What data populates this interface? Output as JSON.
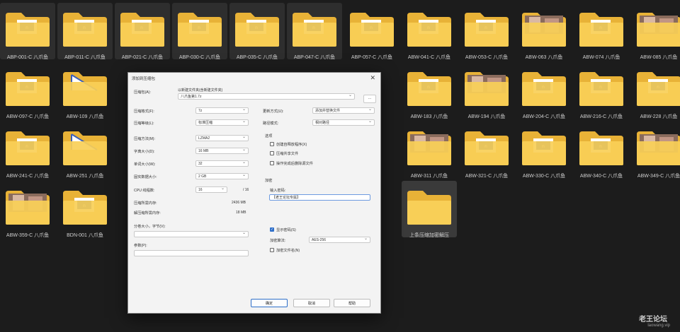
{
  "folders": [
    {
      "label": "ABP-001-C 八爪鱼",
      "thumb": "logo",
      "state": "sel"
    },
    {
      "label": "ABP-011-C 八爪鱼",
      "thumb": "logo",
      "state": "sel"
    },
    {
      "label": "ABP-021-C 八爪鱼",
      "thumb": "logo",
      "state": "sel"
    },
    {
      "label": "ABP-030-C 八爪鱼",
      "thumb": "logo",
      "state": "sel"
    },
    {
      "label": "ABP-035-C 八爪鱼",
      "thumb": "logo",
      "state": "sel"
    },
    {
      "label": "ABP-047-C 八爪鱼",
      "thumb": "logo",
      "state": "sel"
    },
    {
      "label": "ABP-057-C 八爪鱼",
      "thumb": "logo",
      "state": ""
    },
    {
      "label": "ABW-041-C 八爪鱼",
      "thumb": "logo",
      "state": ""
    },
    {
      "label": "ABW-053-C 八爪鱼",
      "thumb": "logo",
      "state": ""
    },
    {
      "label": "ABW-063 八爪鱼",
      "thumb": "photo",
      "state": ""
    },
    {
      "label": "ABW-074 八爪鱼",
      "thumb": "logo",
      "state": ""
    },
    {
      "label": "ABW-085 八爪鱼",
      "thumb": "photo",
      "state": ""
    },
    {
      "label": "ABW-097-C 八爪鱼",
      "thumb": "logo",
      "state": ""
    },
    {
      "label": "ABW-109 八爪鱼",
      "thumb": "doc",
      "state": ""
    },
    {
      "label": "",
      "thumb": "logo",
      "state": "hidden"
    },
    {
      "label": "",
      "thumb": "logo",
      "state": "hidden"
    },
    {
      "label": "",
      "thumb": "logo",
      "state": "hidden"
    },
    {
      "label": "",
      "thumb": "logo",
      "state": "hidden"
    },
    {
      "label": "",
      "thumb": "photo",
      "state": "hidden"
    },
    {
      "label": "ABW-183 八爪鱼",
      "thumb": "logo",
      "state": ""
    },
    {
      "label": "ABW-194 八爪鱼",
      "thumb": "photo",
      "state": ""
    },
    {
      "label": "ABW-204-C 八爪鱼",
      "thumb": "logo",
      "state": ""
    },
    {
      "label": "ABW-216-C 八爪鱼",
      "thumb": "logo",
      "state": ""
    },
    {
      "label": "ABW-228 八爪鱼",
      "thumb": "logo",
      "state": ""
    },
    {
      "label": "ABW-241-C 八爪鱼",
      "thumb": "logo",
      "state": ""
    },
    {
      "label": "ABW-251 八爪鱼",
      "thumb": "doc",
      "state": ""
    },
    {
      "label": "",
      "thumb": "logo",
      "state": "hidden"
    },
    {
      "label": "",
      "thumb": "logo",
      "state": "hidden"
    },
    {
      "label": "",
      "thumb": "logo",
      "state": "hidden"
    },
    {
      "label": "",
      "thumb": "logo",
      "state": "hidden"
    },
    {
      "label": "",
      "thumb": "photo",
      "state": "hidden"
    },
    {
      "label": "ABW-311 八爪鱼",
      "thumb": "photo",
      "state": ""
    },
    {
      "label": "ABW-321-C 八爪鱼",
      "thumb": "logo",
      "state": ""
    },
    {
      "label": "ABW-330-C 八爪鱼",
      "thumb": "logo",
      "state": ""
    },
    {
      "label": "ABW-340-C 八爪鱼",
      "thumb": "logo",
      "state": ""
    },
    {
      "label": "ABW-349-C 八爪鱼",
      "thumb": "photo",
      "state": ""
    },
    {
      "label": "ABW-359-C 八爪鱼",
      "thumb": "photo",
      "state": ""
    },
    {
      "label": "BDN-001 八爪鱼",
      "thumb": "logo",
      "state": ""
    },
    {
      "label": "",
      "thumb": "logo",
      "state": "hidden"
    },
    {
      "label": "",
      "thumb": "logo",
      "state": "hidden"
    },
    {
      "label": "",
      "thumb": "logo",
      "state": "hidden"
    },
    {
      "label": "",
      "thumb": "logo",
      "state": "hidden"
    },
    {
      "label": "",
      "thumb": "logo",
      "state": "hidden"
    },
    {
      "label": "上条压缩加密解压",
      "thumb": "plain",
      "state": "sel2"
    }
  ],
  "dialog": {
    "title": "添加到压缩包",
    "archive_label": "压缩包(A):",
    "archive_hint": "以新建文件夹(含新建文件夹)",
    "archive_value": "八爪鱼第1.7z",
    "browse_label": "...",
    "rows": [
      {
        "label": "压缩格式(F):",
        "value": "7z"
      },
      {
        "label": "压缩等级(L):",
        "value": "标准压缩"
      },
      {
        "label": "压缩方法(M):",
        "value": "LZMA2"
      },
      {
        "label": "字典大小(D):",
        "value": "16 MB"
      },
      {
        "label": "单词大小(W):",
        "value": "32"
      },
      {
        "label": "固实数据大小:",
        "value": "2 GB"
      }
    ],
    "cpu_label": "CPU 线程数:",
    "cpu_value": "16",
    "cpu_total": "/ 16",
    "mem_label": "压缩所需内存:",
    "mem_value": "2436 MB",
    "mem2_label": "解压缩所需内存:",
    "mem2_value": "18 MB",
    "split_label": "分卷大小，字节(V):",
    "params_label": "参数(P):",
    "update_label": "更新方式(U):",
    "update_value": "添加并替换文件",
    "path_label": "路径模式:",
    "path_value": "相对路径",
    "options_title": "选项",
    "options": [
      {
        "label": "创建自释放程序(X)",
        "checked": false
      },
      {
        "label": "压缩共享文件",
        "checked": false
      },
      {
        "label": "操作完成后删除源文件",
        "checked": false
      }
    ],
    "encrypt_title": "加密",
    "password_label": "输入密码:",
    "password_value": "【老王论坛专属】",
    "show_password_label": "显示密码(S)",
    "show_password_checked": true,
    "enc_method_label": "加密算法:",
    "enc_method_value": "AES-256",
    "encrypt_names_label": "加密文件名(N)",
    "encrypt_names_checked": false,
    "ok_label": "确定",
    "cancel_label": "取消",
    "help_label": "帮助"
  },
  "watermark": {
    "line1": "老王论坛",
    "line2": "laowang.vip"
  },
  "colors": {
    "folder_back": "#e8b237",
    "folder_front": "#f8cf57",
    "background": "#1c1c1c",
    "accent": "#2f6fc9"
  }
}
